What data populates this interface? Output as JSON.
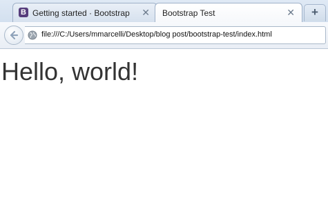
{
  "tabs": [
    {
      "title": "Getting started · Bootstrap",
      "favicon": "bootstrap-b-icon",
      "active": false
    },
    {
      "title": "Bootstrap Test",
      "active": true
    }
  ],
  "tab_close_glyph": "✕",
  "favicon_letter": "B",
  "new_tab_glyph": "+",
  "address_bar": {
    "url": "file:///C:/Users/mmarcelli/Desktop/blog post/bootstrap-test/index.html"
  },
  "page": {
    "heading": "Hello, world!"
  },
  "colors": {
    "bootstrap_purple": "#563d7c",
    "heading_text": "#333333",
    "chrome_bg": "#dfe9f5"
  }
}
